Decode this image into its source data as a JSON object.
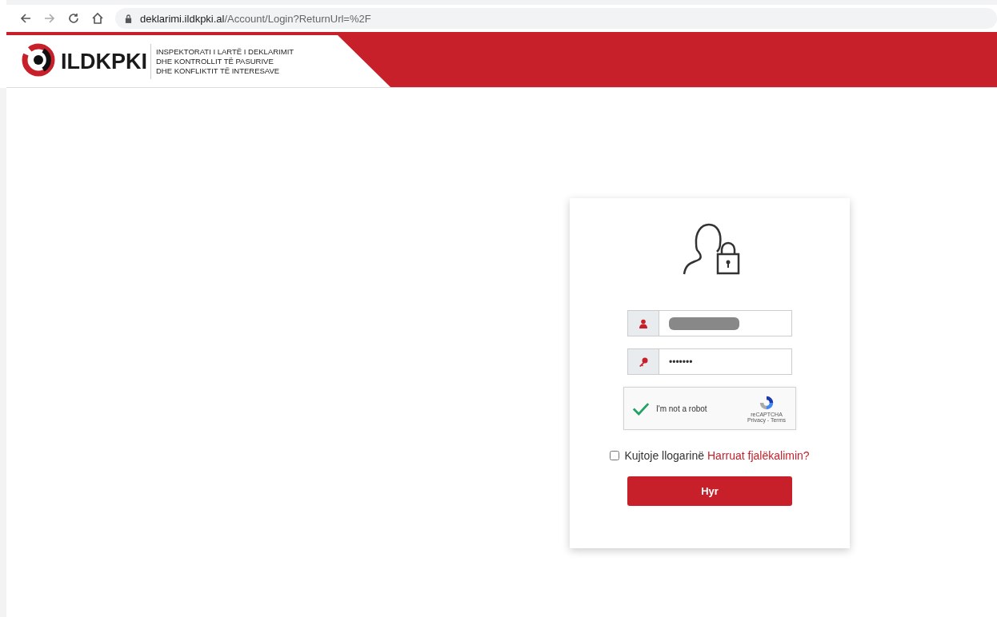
{
  "browser": {
    "url_host": "deklarimi.ildkpki.al",
    "url_path": "/Account/Login?ReturnUrl=%2F"
  },
  "header": {
    "logo_text": "ILDKPKI",
    "subtitle_lines": [
      "INSPEKTORATI I LARTË I DEKLARIMIT",
      "DHE KONTROLLIT TË PASURIVE",
      "DHE KONFLIKTIT TË INTERESAVE"
    ]
  },
  "login": {
    "username": {
      "redacted": true
    },
    "password": {
      "value": "•••••••"
    },
    "captcha": {
      "checked": true,
      "label": "I'm not a robot",
      "brand": "reCAPTCHA",
      "links": "Privacy - Terms"
    },
    "remember": {
      "checked": false,
      "label": "Kujtoje llogarinë"
    },
    "forgot_link": "Harruat fjalëkalimin?",
    "submit": "Hyr"
  }
}
